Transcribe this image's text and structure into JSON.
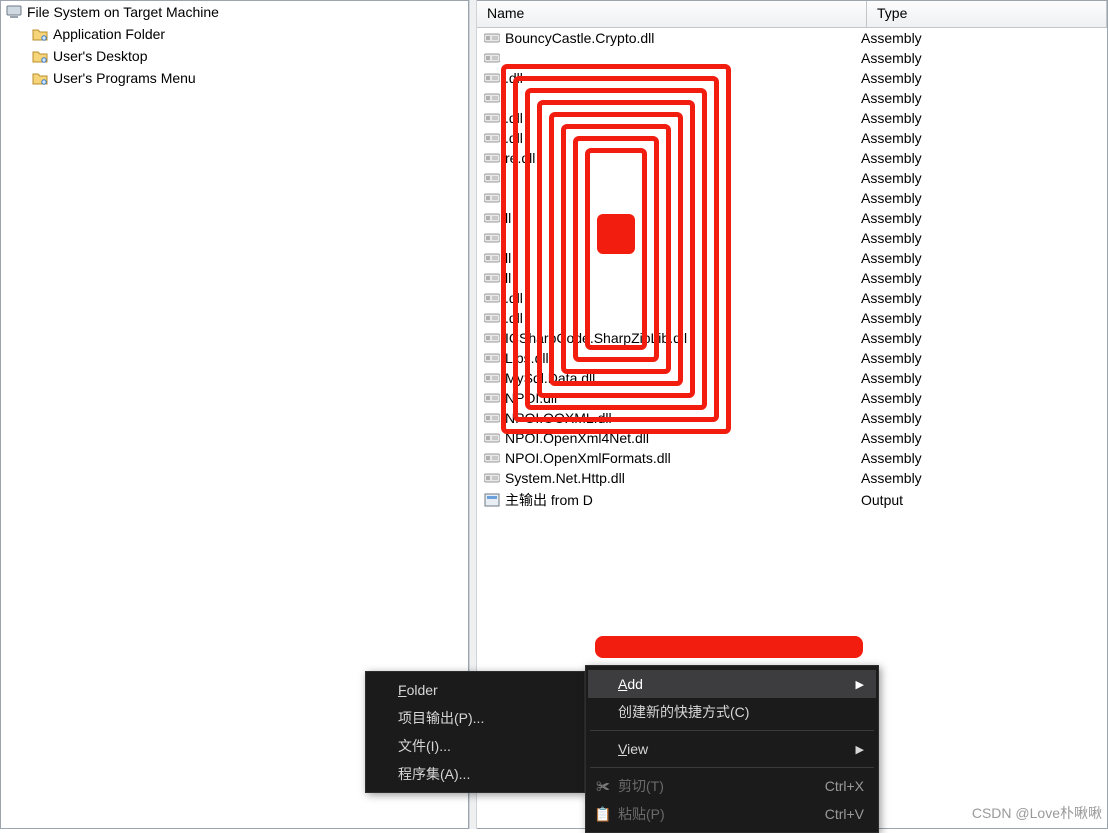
{
  "tree": {
    "root_label": "File System on Target Machine",
    "children": [
      {
        "label": "Application Folder"
      },
      {
        "label": "User's Desktop"
      },
      {
        "label": "User's Programs Menu"
      }
    ]
  },
  "list": {
    "columns": {
      "name": "Name",
      "type": "Type"
    },
    "items": [
      {
        "name": "BouncyCastle.Crypto.dll",
        "type": "Assembly",
        "icon": "assembly"
      },
      {
        "name": "",
        "type": "Assembly",
        "icon": "assembly"
      },
      {
        "name": ".dll",
        "type": "Assembly",
        "icon": "assembly"
      },
      {
        "name": "",
        "type": "Assembly",
        "icon": "assembly"
      },
      {
        "name": ".dll",
        "type": "Assembly",
        "icon": "assembly"
      },
      {
        "name": ".dll",
        "type": "Assembly",
        "icon": "assembly"
      },
      {
        "name": "re.dll",
        "type": "Assembly",
        "icon": "assembly"
      },
      {
        "name": "",
        "type": "Assembly",
        "icon": "assembly"
      },
      {
        "name": "",
        "type": "Assembly",
        "icon": "assembly"
      },
      {
        "name": "ll",
        "type": "Assembly",
        "icon": "assembly"
      },
      {
        "name": "",
        "type": "Assembly",
        "icon": "assembly"
      },
      {
        "name": "ll",
        "type": "Assembly",
        "icon": "assembly"
      },
      {
        "name": "ll",
        "type": "Assembly",
        "icon": "assembly"
      },
      {
        "name": ".dll",
        "type": "Assembly",
        "icon": "assembly"
      },
      {
        "name": ".dll",
        "type": "Assembly",
        "icon": "assembly"
      },
      {
        "name": "ICSharpCode.SharpZipLib.dll",
        "type": "Assembly",
        "icon": "assembly"
      },
      {
        "name": "Libs.dll",
        "type": "Assembly",
        "icon": "assembly"
      },
      {
        "name": "MySql.Data.dll",
        "type": "Assembly",
        "icon": "assembly"
      },
      {
        "name": "NPOI.dll",
        "type": "Assembly",
        "icon": "assembly"
      },
      {
        "name": "NPOI.OOXML.dll",
        "type": "Assembly",
        "icon": "assembly"
      },
      {
        "name": "NPOI.OpenXml4Net.dll",
        "type": "Assembly",
        "icon": "assembly"
      },
      {
        "name": "NPOI.OpenXmlFormats.dll",
        "type": "Assembly",
        "icon": "assembly"
      },
      {
        "name": "System.Net.Http.dll",
        "type": "Assembly",
        "icon": "assembly"
      },
      {
        "name": "主输出 from D",
        "type": "Output",
        "icon": "output"
      }
    ]
  },
  "submenu": {
    "folder": "Folder",
    "project_output": "项目输出(P)...",
    "file": "文件(I)...",
    "assembly": "程序集(A)..."
  },
  "context_menu": {
    "add": "Add",
    "create_shortcut": "创建新的快捷方式(C)",
    "view": "View",
    "cut": "剪切(T)",
    "cut_shortcut": "Ctrl+X",
    "paste": "粘贴(P)",
    "paste_shortcut": "Ctrl+V"
  },
  "watermark": "CSDN @Love朴啾啾"
}
